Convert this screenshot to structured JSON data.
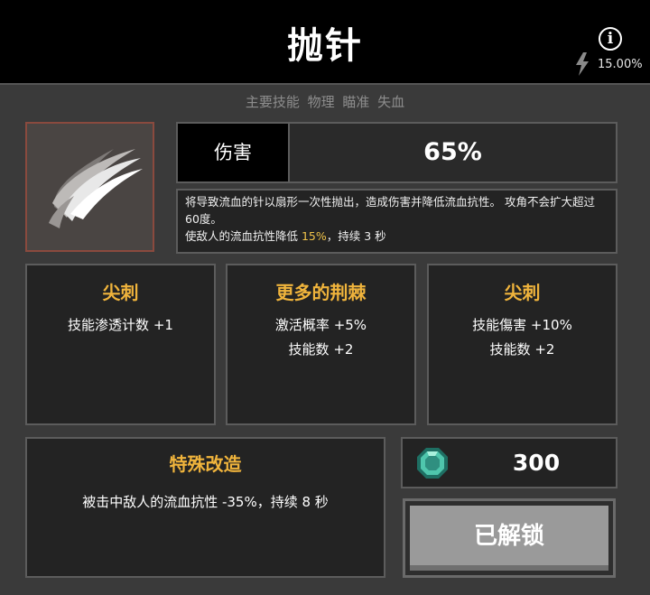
{
  "header": {
    "title": "抛针",
    "info_icon": "info-icon",
    "bolt_icon": "lightning-bolt-icon",
    "chance": "15.00%"
  },
  "tags": "主要技能 物理 瞄准 失血",
  "skill": {
    "icon": "thrown-needle-icon",
    "stat_label": "伤害",
    "stat_value": "65%",
    "desc_line1": "将导致流血的针以扇形一次性抛出，造成伤害并降低流血抗性。 攻角不会扩大超过60度。",
    "desc_line2_prefix": "使敌人的流血抗性降低 ",
    "desc_line2_highlight": "15%",
    "desc_line2_suffix": "，持续 3 秒"
  },
  "modifiers": [
    {
      "title": "尖刺",
      "lines": [
        "技能渗透计数 +1"
      ]
    },
    {
      "title": "更多的荆棘",
      "lines": [
        "激活概率 +5%",
        "技能数 +2"
      ]
    },
    {
      "title": "尖刺",
      "lines": [
        "技能傷害 +10%",
        "技能数 +2"
      ]
    }
  ],
  "special": {
    "title": "特殊改造",
    "text": "被击中敌人的流血抗性 -35%，持续 8 秒"
  },
  "cost": {
    "icon": "gem-currency-icon",
    "value": "300"
  },
  "unlock_button": "已解锁",
  "colors": {
    "accent": "#f0b43c",
    "highlight": "#f0c34a",
    "background": "#3a3a3a",
    "panel": "#232323",
    "header": "#000000"
  }
}
